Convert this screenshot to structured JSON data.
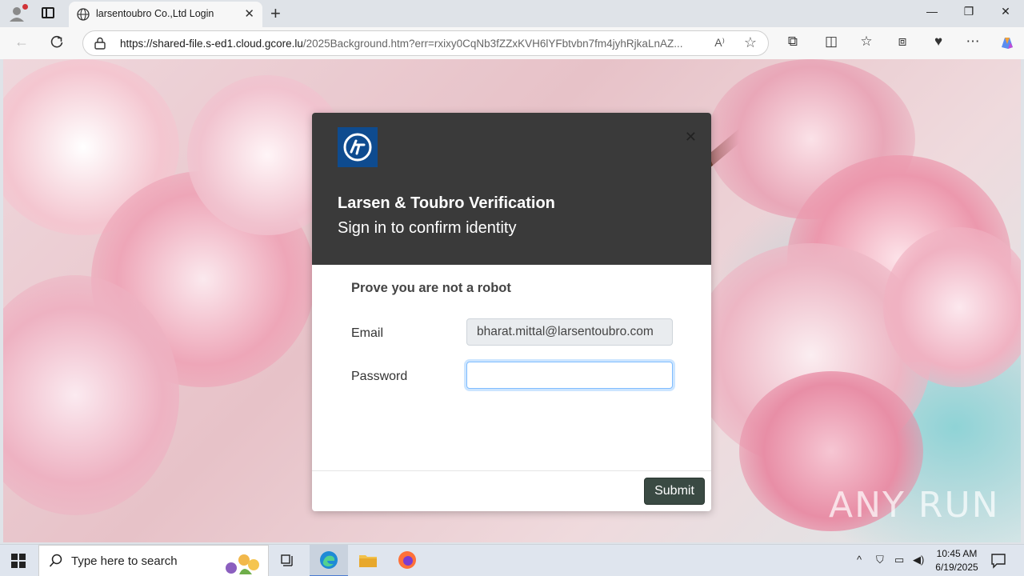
{
  "browser": {
    "tab_title": "larsentoubro Co.,Ltd Login",
    "url_host": "https://shared-file.s-ed1.cloud.gcore.lu",
    "url_rest": "/2025Background.htm?err=rxixy0CqNb3fZZxKVH6lYFbtvbn7fm4jyhRjkaLnAZ...",
    "new_tab": "+",
    "close_tab": "✕",
    "minimize": "—",
    "restore": "❐",
    "close_window": "✕"
  },
  "modal": {
    "title": "Larsen & Toubro Verification",
    "subtitle": "Sign in to confirm identity",
    "close": "✕",
    "heading": "Prove you are not a robot",
    "email_label": "Email",
    "email_value": "bharat.mittal@larsentoubro.com",
    "password_label": "Password",
    "password_value": "",
    "submit_label": "Submit"
  },
  "watermark": "ANY RUN",
  "taskbar": {
    "search_placeholder": "Type here to search",
    "time": "10:45 AM",
    "date": "6/19/2025"
  },
  "colors": {
    "modal_header": "#3a3a3a",
    "logo_blue": "#0e4b8f",
    "submit_bg": "#3a4a43",
    "focus_border": "#80bdff"
  }
}
